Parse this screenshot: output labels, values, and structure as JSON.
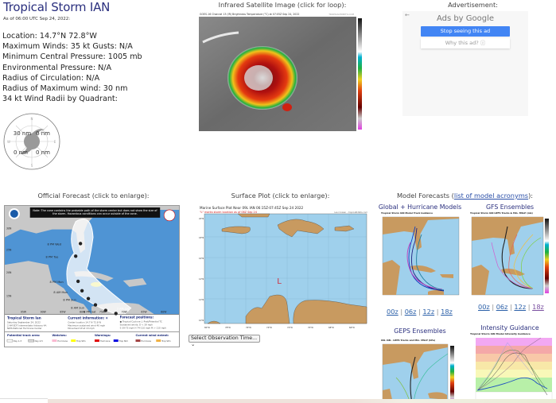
{
  "storm": {
    "title": "Tropical Storm IAN",
    "as_of": "As of 06:00 UTC Sep 24, 2022:",
    "lines": [
      "Location: 14.7°N 72.8°W",
      "Maximum Winds: 35 kt  Gusts: N/A",
      "Minimum Central Pressure: 1005 mb",
      "Environmental Pressure: N/A",
      "Radius of Circulation: N/A",
      "Radius of Maximum wind: 30 nm",
      "34 kt Wind Radii by Quadrant:"
    ],
    "wind_radii": {
      "ne": "0 nm",
      "nw": "30 nm",
      "se": "0 nm",
      "sw": "0 nm",
      "compass": {
        "n": "N",
        "s": "S",
        "e": "E",
        "w": "W"
      }
    }
  },
  "satellite": {
    "heading": "Infrared Satellite Image (click for loop):",
    "image_title": "GOES-16 Channel 13 (IR) Brightness Temperature (°C) at 07:05Z Sep 24, 2022",
    "credit": "TROPICALTIDBITS.COM"
  },
  "ad": {
    "heading": "Advertisement:",
    "back_icon": "←",
    "ads_by": "Ads by Google",
    "stop_label": "Stop seeing this ad",
    "why_label": "Why this ad? ⓘ",
    "colors": {
      "stop_button": "#4285f4"
    }
  },
  "official": {
    "heading": "Official Forecast (click to enlarge):",
    "note": "Note: The cone contains the probable path of the storm center but does not show the size of the storm. Hazardous conditions can occur outside of the cone.",
    "forecast_labels": [
      "8 PM Wed",
      "8 PM Tue",
      "8 PM Mon",
      "8 AM Mon",
      "8 PM Sun",
      "8 AM Sun",
      "8 PM Sat",
      "2 AM Sat"
    ],
    "lat_labels": [
      "30N",
      "25N",
      "20N",
      "15N"
    ],
    "lon_labels": [
      "95W",
      "90W",
      "85W",
      "80W",
      "75W",
      "70W",
      "65W",
      "60W"
    ],
    "legend": {
      "storm_name": "Tropical Storm Ian",
      "date": "Saturday September 24, 2022",
      "advisory": "2 AM EDT Intermediate Advisory 4A",
      "center": "NWS National Hurricane Center",
      "current_info_title": "Current information: ×",
      "current_info": [
        "Center location 14.7 N 72.8 W",
        "Maximum sustained wind 40 mph",
        "Movement W at 13 mph"
      ],
      "forecast_positions_title": "Forecast positions:",
      "forecast_positions": [
        "● Tropical Cyclone  ○ Post/Potential TC",
        "Sustained winds:   D < 39 mph",
        "S 39-73 mph  H 74-110 mph  M > 110 mph"
      ],
      "track_area_title": "Potential track area:",
      "track_area": [
        "Day 1-3",
        "Day 4-5"
      ],
      "watches_title": "Watches:",
      "watches": [
        "Hurricane",
        "Trop Stm"
      ],
      "warnings_title": "Warnings:",
      "warnings": [
        "Hurricane",
        "Trop Stm"
      ],
      "wind_extent_title": "Current wind extent:",
      "wind_extent": [
        "Hurricane",
        "Trop Stm"
      ]
    }
  },
  "surface": {
    "heading": "Surface Plot (click to enlarge):",
    "plot_title": "Marine Surface Plot Near 09L IAN 06:15Z-07:45Z Sep 24 2022",
    "plot_subtitle": "\"L\" marks storm location as of 06Z Sep 24",
    "credit": "Levi Cowan - tropicaltidbits.com",
    "storm_marker": "L",
    "lat_labels": [
      "20°N",
      "18°N",
      "16°N",
      "14°N",
      "12°N",
      "10°N"
    ],
    "lon_labels": [
      "80°W",
      "78°W",
      "76°W",
      "74°W",
      "72°W",
      "70°W",
      "68°W",
      "66°W"
    ],
    "select_label": "Select Observation Time... ⌄"
  },
  "models": {
    "heading_prefix": "Model Forecasts (",
    "heading_link": "list of model acronyms",
    "heading_suffix": "):",
    "global": {
      "heading": "Global + Hurricane Models",
      "title": "Tropical Storm IAN Model Track Guidance"
    },
    "gfs": {
      "heading": "GFS Ensembles",
      "title": "Tropical Storm IAN GEFS Tracks & Min. MSLP (mb)"
    },
    "geps": {
      "heading": "GEPS Ensembles",
      "title": "09L IAN - GEPS Tracks and Min. MSLP (hPa)"
    },
    "intensity": {
      "heading": "Intensity Guidance",
      "title": "Tropical Storm IAN Model Intensity Guidance"
    },
    "runs_global": [
      "00z",
      "06z",
      "12z",
      "18z"
    ],
    "runs_gfs": [
      "00z",
      "06z",
      "12z",
      "18z"
    ],
    "separator": "|"
  }
}
